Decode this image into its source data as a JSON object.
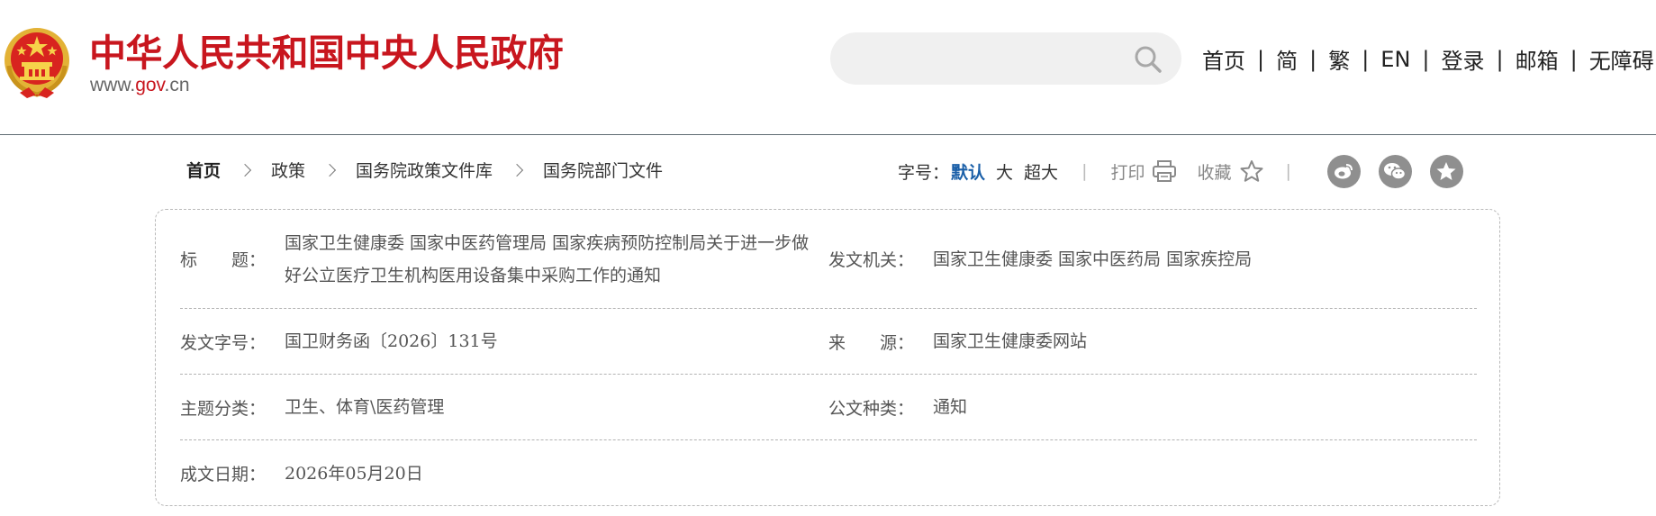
{
  "header": {
    "site_title": "中华人民共和国中央人民政府",
    "domain_prefix": "www.",
    "domain_accent": "gov",
    "domain_suffix": ".cn",
    "search_placeholder": "",
    "brand_red": "#c8161e",
    "top_links": [
      "首页",
      "简",
      "繁",
      "EN",
      "登录",
      "邮箱",
      "无障碍"
    ],
    "separator": "|"
  },
  "breadcrumb": {
    "items": [
      "首页",
      "政策",
      "国务院政策文件库",
      "国务院部门文件"
    ]
  },
  "toolbar": {
    "font_size_label": "字号：",
    "font_size_options": [
      "默认",
      "大",
      "超大"
    ],
    "font_size_active": "默认",
    "print_label": "打印",
    "favorite_label": "收藏",
    "share_icons": [
      "weibo-icon",
      "wechat-icon",
      "star-badge-icon"
    ],
    "divider": "|"
  },
  "info": {
    "title_label": "标　　题：",
    "title_value": "国家卫生健康委 国家中医药管理局 国家疾病预防控制局关于进一步做好公立医疗卫生机构医用设备集中采购工作的通知",
    "issuer_label": "发文机关：",
    "issuer_value": "国家卫生健康委 国家中医药局 国家疾控局",
    "doc_number_label": "发文字号：",
    "doc_number_value": "国卫财务函〔2026〕131号",
    "source_label": "来　　源：",
    "source_value": "国家卫生健康委网站",
    "category_label": "主题分类：",
    "category_value": "卫生、体育\\医药管理",
    "doc_type_label": "公文种类：",
    "doc_type_value": "通知",
    "date_label": "成文日期：",
    "date_value": "2026年05月20日"
  }
}
